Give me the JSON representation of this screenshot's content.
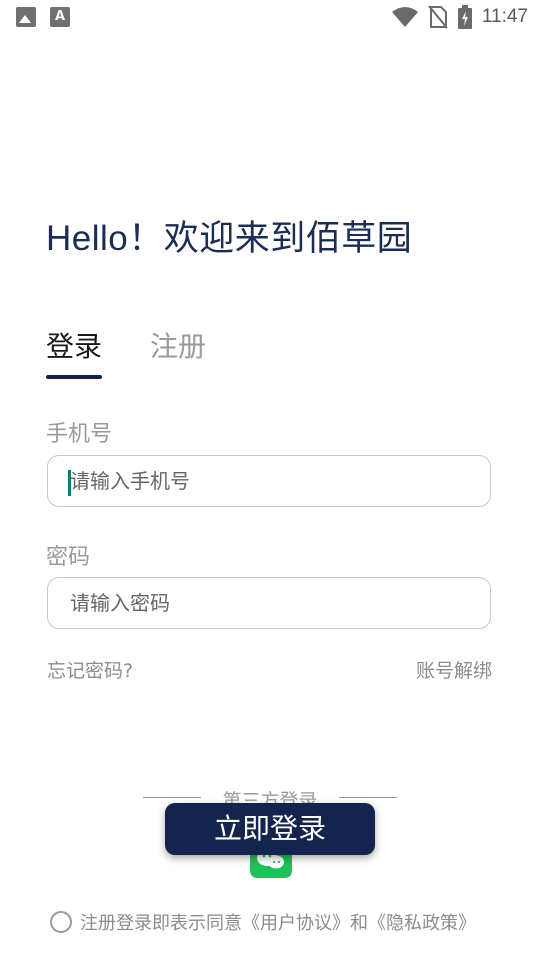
{
  "status_bar": {
    "time": "11:47",
    "notif_icon": "A"
  },
  "greeting": "Hello！欢迎来到佰草园",
  "tabs": [
    {
      "label": "登录",
      "active": true
    },
    {
      "label": "注册",
      "active": false
    }
  ],
  "form": {
    "phone_label": "手机号",
    "phone_placeholder": "请输入手机号",
    "password_label": "密码",
    "password_placeholder": "请输入密码"
  },
  "links": {
    "forgot": "忘记密码?",
    "unbind": "账号解绑"
  },
  "third_party": {
    "label": "第三方登录",
    "icon": "wechat-icon"
  },
  "login_button": "立即登录",
  "agreement": "注册登录即表示同意《用户协议》和《隐私政策》",
  "colors": {
    "primary": "#14254d",
    "wechat": "#1fc25a"
  }
}
